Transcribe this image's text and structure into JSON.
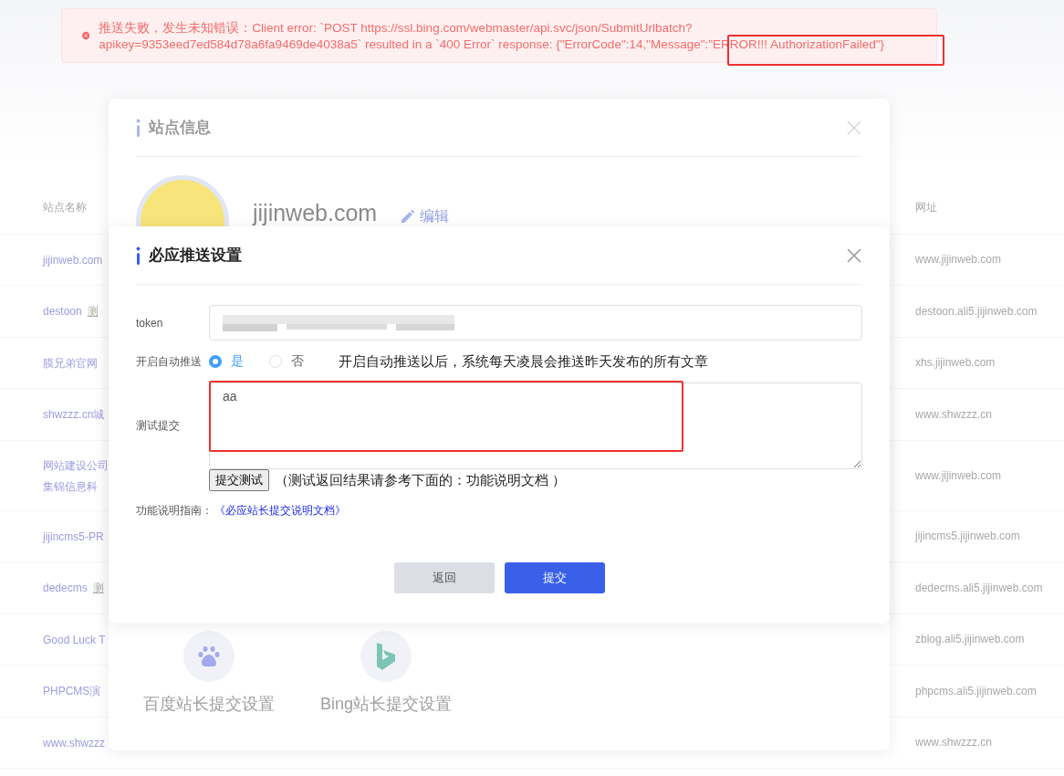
{
  "toast": {
    "kind": "error",
    "message": "推送失败，发生未知错误：Client error: `POST https://ssl.bing.com/webmaster/api.svc/json/SubmitUrlbatch?apikey=9353eed7ed584d78a6fa9469de4038a5` resulted in a `400 Error` response: {\"ErrorCode\":14,\"Message\":\"ERROR!!! AuthorizationFailed\"}",
    "highlighted": true
  },
  "table": {
    "columns": [
      "站点名称",
      "网址"
    ],
    "rows": [
      {
        "name": [
          "jijinweb.com"
        ],
        "url": "www.jijinweb.com"
      },
      {
        "name": [
          "destoon"
        ],
        "tag": "测",
        "url": "destoon.ali5.jijinweb.com"
      },
      {
        "name": [
          "膜兄弟官网"
        ],
        "url": "xhs.jijinweb.com"
      },
      {
        "name": [
          "shwzzz.cn城"
        ],
        "url": "www.shwzzz.cn"
      },
      {
        "name": [
          "网站建设公司",
          "集锦信息科"
        ],
        "url": "www.jijinweb.com"
      },
      {
        "name": [
          "jijincms5-PR"
        ],
        "url": "jijincms5.jijinweb.com"
      },
      {
        "name": [
          "dedecms"
        ],
        "tag": "测",
        "url": "dedecms.ali5.jijinweb.com"
      },
      {
        "name": [
          "Good Luck T"
        ],
        "url": "zblog.ali5.jijinweb.com"
      },
      {
        "name": [
          "PHPCMS演"
        ],
        "url": "phpcms.ali5.jijinweb.com"
      },
      {
        "name": [
          "www.shwzzz"
        ],
        "url": "www.shwzzz.cn"
      }
    ]
  },
  "info_dialog": {
    "title": "站点信息",
    "site_name": "jijinweb.com",
    "edit_label": "编辑",
    "platforms": [
      {
        "kind": "baidu",
        "label": "百度站长提交设置"
      },
      {
        "kind": "bing",
        "label": "Bing站长提交设置"
      }
    ]
  },
  "push_dialog": {
    "title": "必应推送设置",
    "token": {
      "label": "token"
    },
    "auto_push": {
      "label": "开启自动推送",
      "options": [
        {
          "label": "是",
          "selected": true
        },
        {
          "label": "否",
          "selected": false
        }
      ],
      "hint": "开启自动推送以后，系统每天凌晨会推送昨天发布的所有文章"
    },
    "test": {
      "label": "测试提交",
      "value": "aa",
      "highlighted": true,
      "button": "提交测试",
      "note": "（测试返回结果请参考下面的：功能说明文档 ）"
    },
    "guide": {
      "label": "功能说明指南：",
      "link": "《必应站长提交说明文档》"
    },
    "buttons": [
      {
        "label": "返回",
        "kind": "secondary"
      },
      {
        "label": "提交",
        "kind": "primary"
      }
    ]
  }
}
